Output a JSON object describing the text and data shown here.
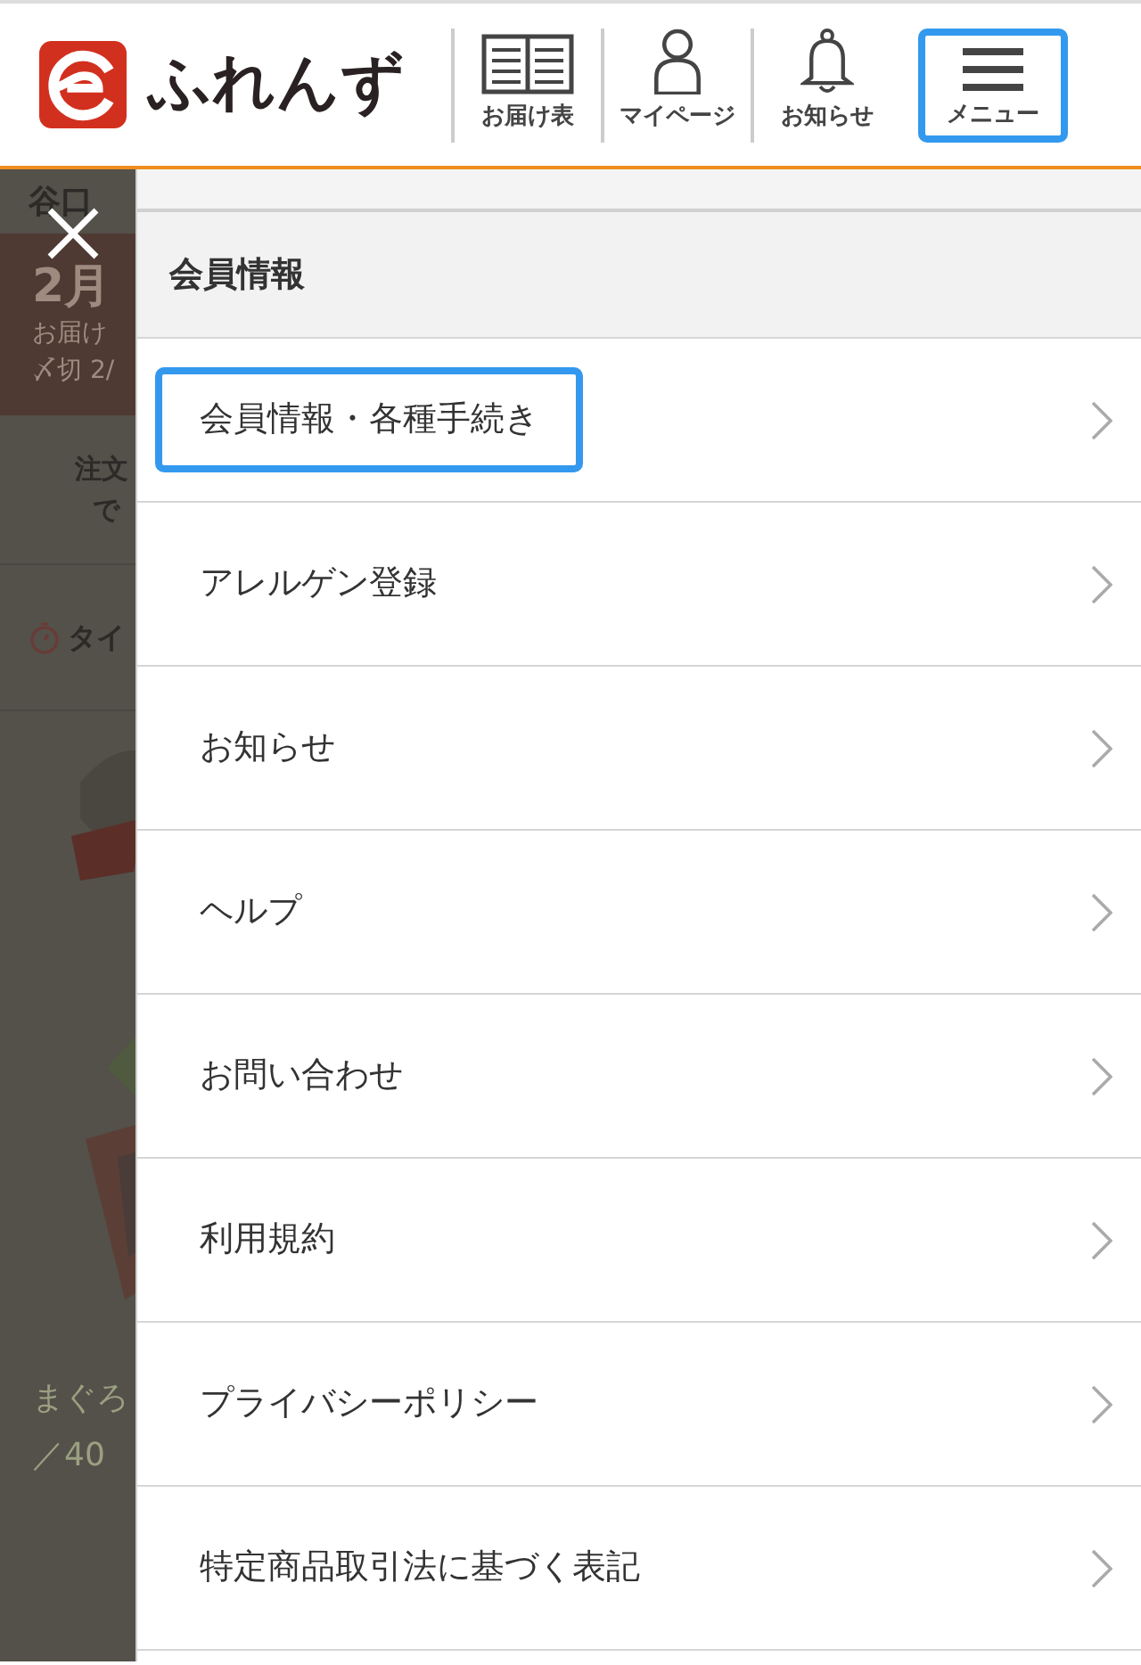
{
  "header": {
    "logo_text": "ふれんず",
    "nav": [
      {
        "kind": "book",
        "label": "お届け表",
        "highlighted": false
      },
      {
        "kind": "person",
        "label": "マイページ",
        "highlighted": false
      },
      {
        "kind": "bell",
        "label": "お知らせ",
        "highlighted": false
      },
      {
        "kind": "menu",
        "label": "メニュー",
        "highlighted": true
      }
    ]
  },
  "background": {
    "name": "谷口 ",
    "deadline_month": "2月",
    "delivery": "お届け",
    "deadline": "〆切 2/",
    "notice_line_1": "注文",
    "notice_line_2": "で",
    "timer_label": "タイ",
    "product_name": "まぐろ",
    "product_price": "／40"
  },
  "menu": {
    "section_title": "会員情報",
    "items": [
      {
        "label": "会員情報・各種手続き",
        "highlighted": true
      },
      {
        "label": "アレルゲン登録",
        "highlighted": false
      },
      {
        "label": "お知らせ",
        "highlighted": false
      },
      {
        "label": "ヘルプ",
        "highlighted": false
      },
      {
        "label": "お問い合わせ",
        "highlighted": false
      },
      {
        "label": "利用規約",
        "highlighted": false
      },
      {
        "label": "プライバシーポリシー",
        "highlighted": false
      },
      {
        "label": "特定商品取引法に基づく表記",
        "highlighted": false
      }
    ]
  }
}
